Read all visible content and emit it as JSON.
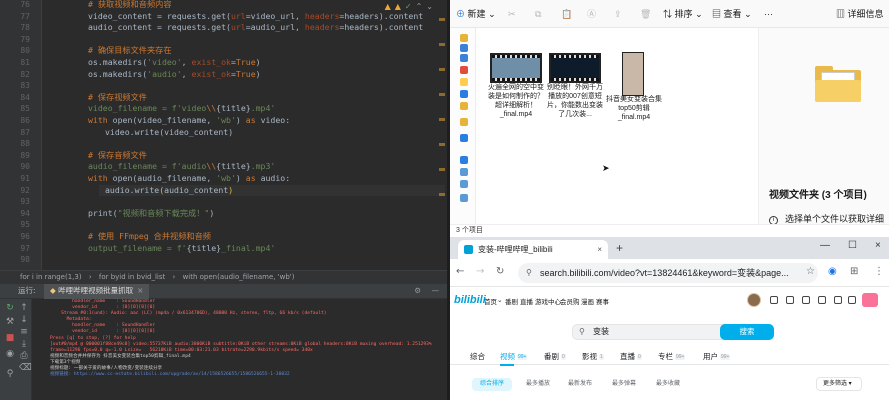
{
  "ide": {
    "line_numbers": [
      "76",
      "77",
      "78",
      "79",
      "80",
      "81",
      "82",
      "83",
      "84",
      "85",
      "86",
      "87",
      "88",
      "89",
      "90",
      "91",
      "92",
      "93",
      "94",
      "95",
      "96",
      "97",
      "98"
    ],
    "code": {
      "c76": "# 获取视频和音频内容",
      "c77a": "video_content = requests.get(",
      "c77b": "url",
      "c77c": "=video_url, ",
      "c77d": "headers",
      "c77e": "=headers).content",
      "c78a": "audio_content = requests.get(",
      "c78b": "url",
      "c78c": "=audio_url, ",
      "c78d": "headers",
      "c78e": "=headers).content",
      "c80": "# 确保目标文件夹存在",
      "c81a": "os.makedirs(",
      "c81b": "'video'",
      "c81c": ", ",
      "c81d": "exist_ok",
      "c81e": "=",
      "c81f": "True",
      "c81g": ")",
      "c82a": "os.makedirs(",
      "c82b": "'audio'",
      "c82c": ", ",
      "c82d": "exist_ok",
      "c82e": "=",
      "c82f": "True",
      "c82g": ")",
      "c84": "# 保存视频文件",
      "c85a": "video_filename = f'video",
      "c85b": "\\\\",
      "c85c": "{title}",
      "c85d": ".mp4'",
      "c86a": "with ",
      "c86b": "open",
      "c86c": "(video_filename, ",
      "c86d": "'wb'",
      "c86e": ") ",
      "c86f": "as ",
      "c86g": "video:",
      "c87": "video.write(video_content)",
      "c89": "# 保存音频文件",
      "c90a": "audio_filename = f'audio",
      "c90b": "\\\\",
      "c90c": "{title}",
      "c90d": ".mp3'",
      "c91a": "with ",
      "c91b": "open",
      "c91c": "(audio_filename, ",
      "c91d": "'wb'",
      "c91e": ") ",
      "c91f": "as ",
      "c91g": "audio:",
      "c92a": "audio.write",
      "c92b": "(",
      "c92c": "audio_content",
      "c92d": ")",
      "c94a": "print(",
      "c94b": "\"视频和音频下载完成！\"",
      "c94c": ")",
      "c96": "# 使用 FFmpeg 合并视频和音频",
      "c97a": "output_filename = f'",
      "c97b": "{title}",
      "c97c": "_final.mp4'"
    },
    "breadcrumbs": [
      "for i in range(1,3)",
      "›",
      "for byid in bvid_list",
      "›",
      "with open(audio_filename, 'wb')"
    ],
    "run_label": "运行:",
    "run_tab": "哔哩哔哩视频批量抓取",
    "run_tab_close": "×",
    "run_right_icons": [
      "⚙",
      "—"
    ],
    "console_lines": [
      {
        "t": "        handler_name    : SoundHandler",
        "c": ""
      },
      {
        "t": "        vendor_id       : [0][0][0][0]",
        "c": ""
      },
      {
        "t": "    Stream #0:1(und): Audio: aac (LC) (mp4a / 0x6134706D), 48000 Hz, stereo, fltp, 66 kb/s (default)",
        "c": ""
      },
      {
        "t": "      Metadata:",
        "c": ""
      },
      {
        "t": "        handler_name    : SoundHandler",
        "c": ""
      },
      {
        "t": "        vendor_id       : [0][0][0][0]",
        "c": ""
      },
      {
        "t": "Press [q] to stop, [?] for help",
        "c": ""
      },
      {
        "t": "[out#0/mp4 @ 000001f88ce49c0] video:55737KiB audio:3806KiB subtitle:0KiB other streams:0KiB global headers:0KiB muxing overhead: 1.251293%",
        "c": ""
      },
      {
        "t": "frame=11296 fps=0.0 q=-1.0 Lsize=   56210KiB time=00:03:21.03 bitrate=2290.9kbits/s speed= 340x",
        "c": ""
      },
      {
        "t": "视频和音频合并并保存为 抖音美女变装合集top50剪辑_final.mp4",
        "c": "w"
      },
      {
        "t": "下载第3个视频",
        "c": "w"
      },
      {
        "t": "视频标题: 一部关于爱的故事/人物改变/变装连续分享",
        "c": "w"
      },
      {
        "t": "视频链接: https://www.cc-estate.bilibili.com/upgrade/av/14/1586526655/1586526655-1-30032",
        "c": "b"
      }
    ]
  },
  "explorer": {
    "new_label": "新建",
    "sort_label": "排序",
    "view_label": "查看",
    "more_label": "···",
    "details_label": "详细信息",
    "files": [
      {
        "name": "火遍全网的空中变装是如何制作的？超详细解析！_final.mp4"
      },
      {
        "name": "别眨眼！外网千万播放的007创意短片，你能数出变装了几次装..."
      },
      {
        "name": "抖音美女变装合集top50剪辑_final.mp4"
      }
    ],
    "detail_title": "视频文件夹 (3 个项目)",
    "detail_info": "选择单个文件以获取详细信息并共享云内容。",
    "detail_info_icon": "i",
    "status": "3 个项目"
  },
  "browser": {
    "tab_title": "变装-哔哩哔哩_bilibili",
    "tab_close": "×",
    "new_tab": "+",
    "window_controls": [
      "—",
      "☐",
      "×"
    ],
    "url": "search.bilibili.com/video?vt=13824461&keyword=变装&page...",
    "logo": "bilibili",
    "nav_items": [
      "首页",
      "番剧",
      "直播",
      "游戏中心",
      "会员购",
      "漫画",
      "赛事"
    ],
    "search_value": "变装",
    "search_button": "搜索",
    "categories": [
      {
        "label": "综合",
        "count": ""
      },
      {
        "label": "视频",
        "count": "99+"
      },
      {
        "label": "番剧",
        "count": "0"
      },
      {
        "label": "影视",
        "count": "1"
      },
      {
        "label": "直播",
        "count": "0"
      },
      {
        "label": "专栏",
        "count": "99+"
      },
      {
        "label": "用户",
        "count": "99+"
      }
    ],
    "filters": [
      "综合排序",
      "最多播放",
      "最新发布",
      "最多弹幕",
      "最多收藏"
    ],
    "more_filters": "更多筛选 ▾",
    "accent_color": "#00aeec"
  }
}
